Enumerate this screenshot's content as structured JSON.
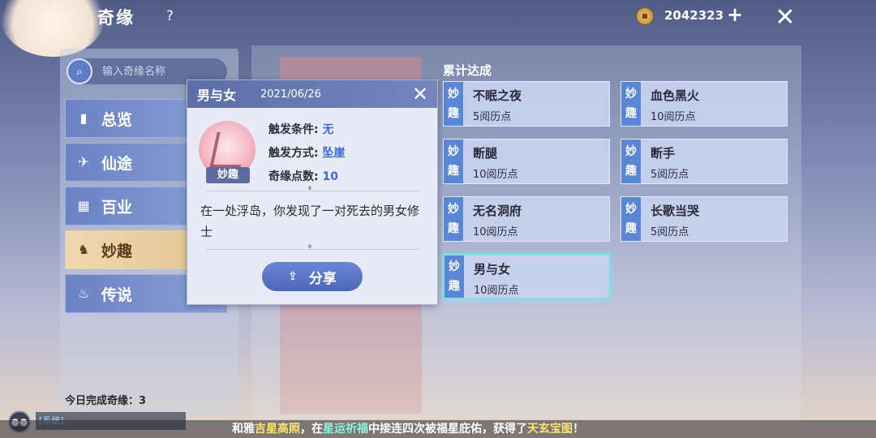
{
  "topbar": {
    "title": "奇缘",
    "help": "?",
    "coins": "2042323",
    "plus": "+",
    "close": "✕"
  },
  "search": {
    "placeholder": "输入奇缘名称"
  },
  "sidebar": {
    "items": [
      {
        "label": "总览",
        "icon": "book-icon"
      },
      {
        "label": "仙途",
        "icon": "bird-icon"
      },
      {
        "label": "百业",
        "icon": "abacus-icon"
      },
      {
        "label": "妙趣",
        "icon": "figure-icon"
      },
      {
        "label": "传说",
        "icon": "cauldron-icon"
      }
    ],
    "active_index": 3,
    "today_label": "今日完成奇缘：3"
  },
  "main": {
    "section_title": "累计达成",
    "cards": [
      {
        "tag": "妙趣",
        "name": "不眠之夜",
        "points": "5阅历点"
      },
      {
        "tag": "妙趣",
        "name": "血色黑火",
        "points": "10阅历点"
      },
      {
        "tag": "妙趣",
        "name": "断腿",
        "points": "10阅历点"
      },
      {
        "tag": "妙趣",
        "name": "断手",
        "points": "5阅历点"
      },
      {
        "tag": "妙趣",
        "name": "无名洞府",
        "points": "10阅历点"
      },
      {
        "tag": "妙趣",
        "name": "长歌当哭",
        "points": "5阅历点"
      },
      {
        "tag": "妙趣",
        "name": "男与女",
        "points": "10阅历点"
      }
    ],
    "selected_index": 6
  },
  "popup": {
    "title": "男与女",
    "date": "2021/06/26",
    "emblem_tag": "妙趣",
    "condition_label": "触发条件: ",
    "condition_value": "无",
    "method_label": "触发方式: ",
    "method_value": "坠崖",
    "points_label": "奇缘点数: ",
    "points_value": "10",
    "description": "在一处浮岛，你发现了一对死去的男女修士",
    "share_label": "分享"
  },
  "chat": {
    "left_text": "[系统]",
    "p1": "和雅",
    "p2": "吉星高照",
    "p3": "，在",
    "p4": "星运祈福",
    "p5": "中接连四次被福星庇佑，获得了",
    "p6": "天玄宝图",
    "p7": "！"
  }
}
